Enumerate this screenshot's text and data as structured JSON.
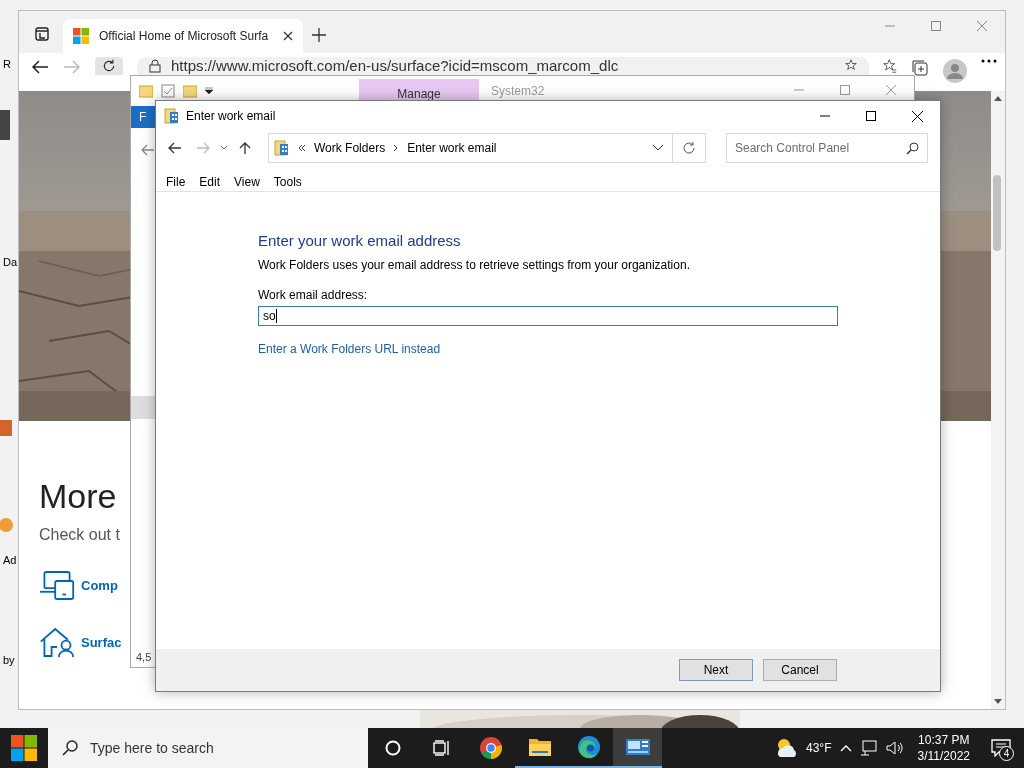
{
  "desktop": {
    "icon_labels": [
      "R",
      "Da",
      "Ad",
      "by"
    ]
  },
  "browser": {
    "tab": {
      "title": "Official Home of Microsoft Surfa",
      "selected": true
    },
    "address": "https://www.microsoft.com/en-us/surface?icid=mscom_marcom_dlc",
    "page": {
      "heading": "More",
      "subheading": "Check out t",
      "links": [
        "Comp",
        "Surfac"
      ]
    }
  },
  "explorer": {
    "context_tab": "Manage",
    "title": "System32",
    "ribbon_tab": "F",
    "status": "4,5"
  },
  "dialog": {
    "title": "Enter work email",
    "breadcrumb": [
      "Work Folders",
      "Enter work email"
    ],
    "search": {
      "placeholder": "Search Control Panel"
    },
    "menu": [
      "File",
      "Edit",
      "View",
      "Tools"
    ],
    "heading": "Enter your work email address",
    "description": "Work Folders uses your email address to retrieve settings from your organization.",
    "field": {
      "label": "Work email address:",
      "value": "so"
    },
    "link": "Enter a Work Folders URL instead",
    "buttons": [
      "Next",
      "Cancel"
    ]
  },
  "taskbar": {
    "search": {
      "placeholder": "Type here to search"
    },
    "apps": [
      {
        "kind": "chrome",
        "running": false,
        "selected": false
      },
      {
        "kind": "explorer",
        "running": true,
        "selected": false
      },
      {
        "kind": "edge",
        "running": true,
        "selected": false
      },
      {
        "kind": "control",
        "running": true,
        "selected": true
      }
    ],
    "weather": "43°F",
    "time": "10:37 PM",
    "date": "3/11/2022",
    "notifications": "4"
  }
}
